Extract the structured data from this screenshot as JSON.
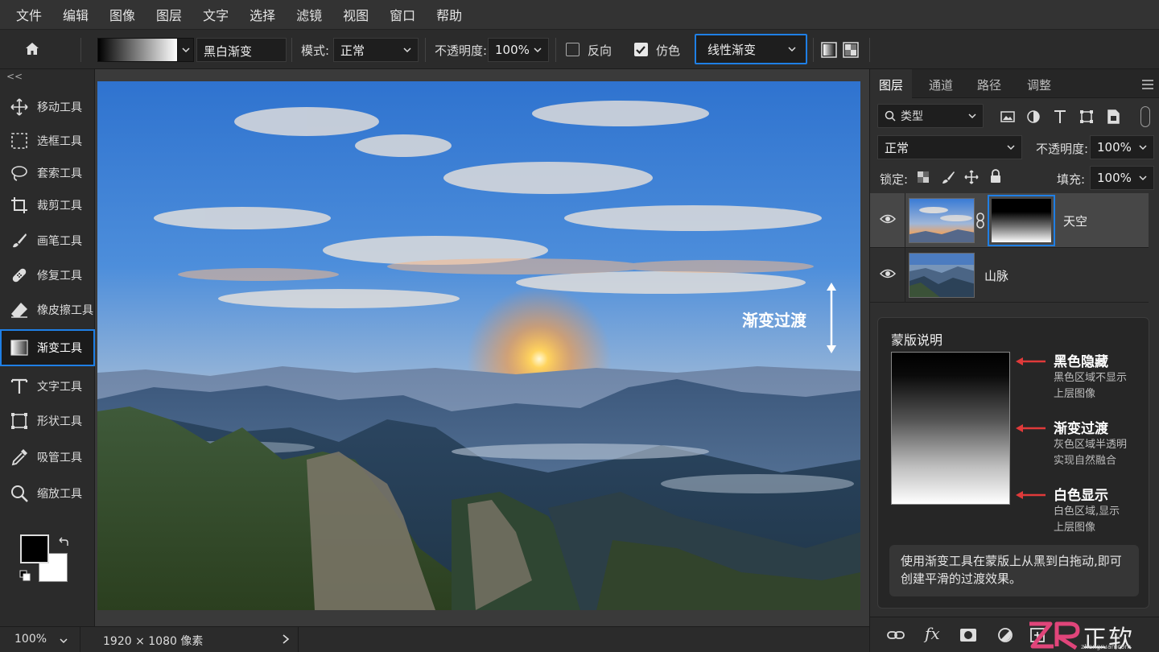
{
  "menubar": {
    "items": [
      "文件",
      "编辑",
      "图像",
      "图层",
      "文字",
      "选择",
      "滤镜",
      "视图",
      "窗口",
      "帮助"
    ]
  },
  "options": {
    "preset_name": "黑白渐变",
    "mode_label": "模式:",
    "mode_value": "正常",
    "opacity_label": "不透明度:",
    "opacity_value": "100%",
    "reverse_label": "反向",
    "reverse_checked": false,
    "dither_label": "仿色",
    "dither_checked": true,
    "gradient_type": "线性渐变"
  },
  "toolbar": {
    "collapse": "<<",
    "tools": [
      {
        "label": "移动工具",
        "icon": "move-icon"
      },
      {
        "label": "选框工具",
        "icon": "marquee-icon"
      },
      {
        "label": "套索工具",
        "icon": "lasso-icon"
      },
      {
        "label": "裁剪工具",
        "icon": "crop-icon"
      },
      {
        "label": "画笔工具",
        "icon": "brush-icon"
      },
      {
        "label": "修复工具",
        "icon": "healing-icon"
      },
      {
        "label": "橡皮擦工具",
        "icon": "eraser-icon"
      },
      {
        "label": "渐变工具",
        "icon": "gradient-icon",
        "active": true
      },
      {
        "label": "文字工具",
        "icon": "type-icon"
      },
      {
        "label": "形状工具",
        "icon": "shape-icon"
      },
      {
        "label": "吸管工具",
        "icon": "eyedropper-icon"
      },
      {
        "label": "缩放工具",
        "icon": "zoom-icon"
      }
    ],
    "foreground_color": "#000000",
    "background_color": "#ffffff"
  },
  "canvas": {
    "annotation": "渐变过渡"
  },
  "status": {
    "zoom": "100%",
    "dimensions": "1920 × 1080 像素"
  },
  "panel": {
    "tabs": [
      "图层",
      "通道",
      "路径",
      "调整"
    ],
    "active_tab": "图层",
    "filter_label": "类型",
    "blend_mode": "正常",
    "opacity_label": "不透明度:",
    "opacity_value": "100%",
    "lock_label": "锁定:",
    "fill_label": "填充:",
    "fill_value": "100%",
    "layers": [
      {
        "name": "天空",
        "selected": true,
        "has_mask": true
      },
      {
        "name": "山脉",
        "selected": false,
        "has_mask": false
      }
    ],
    "mask_card": {
      "title": "蒙版说明",
      "items": [
        {
          "heading": "黑色隐藏",
          "desc1": "黑色区域不显示",
          "desc2": "上层图像"
        },
        {
          "heading": "渐变过渡",
          "desc1": "灰色区域半透明",
          "desc2": "实现自然融合"
        },
        {
          "heading": "白色显示",
          "desc1": "白色区域,显示",
          "desc2": "上层图像"
        }
      ],
      "note": "使用渐变工具在蒙版上从黑到白拖动,即可创建平滑的过渡效果。"
    },
    "watermark": {
      "text": "正软",
      "sub": "zhengruan.com"
    }
  },
  "colors": {
    "accent": "#1f7fe5",
    "annotation_arrow": "#e03a3a"
  }
}
